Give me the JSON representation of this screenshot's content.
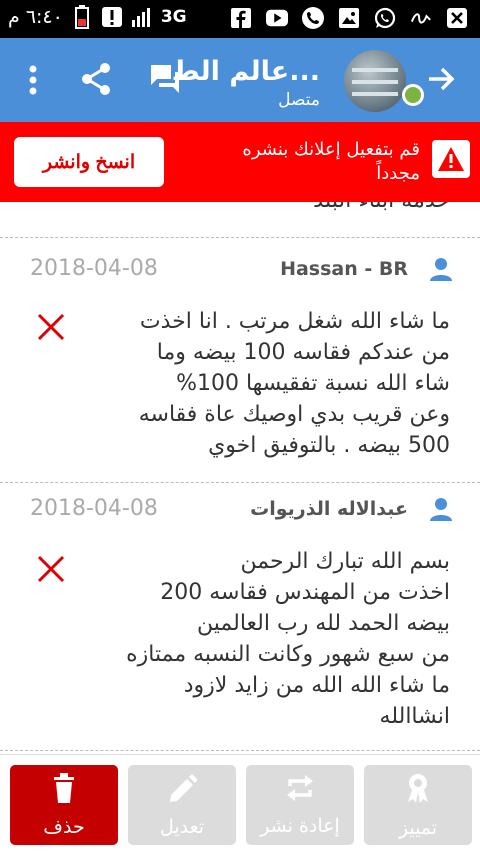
{
  "status_bar": {
    "time": "٦:٤٠ م",
    "network": "3G",
    "icons": [
      "battery-icon",
      "alert-icon",
      "signal-icon",
      "facebook-icon",
      "youtube-icon",
      "phone-icon",
      "gallery-icon",
      "whatsapp-icon",
      "ink-icon",
      "close-box-icon"
    ]
  },
  "app_bar": {
    "title": "عالم الط...",
    "subtitle": "متصل",
    "color": "#4A8FD7"
  },
  "alert": {
    "message": "قم بتفعيل إعلانك بنشره مجدداً",
    "button_label": "انسخ وانشر",
    "color": "#FF0000"
  },
  "feed": {
    "top_fragment": "خدمة ابناء البلد",
    "reviews": [
      {
        "name": "Hassan - BR",
        "date": "2018-04-08",
        "text": "ما شاء الله شغل مرتب . انا اخذت\nمن عندكم فقاسه 100 بيضه وما\nشاء الله  نسبة تفقيسها  100%\nوعن قريب بدي  اوصيك عاة فقاسه\n500 بيضه .  بالتوفيق اخوي"
      },
      {
        "name": "عبدالاله الذريوات",
        "date": "2018-04-08",
        "text": "بسم الله تبارك الرحمن\nاخذت من المهندس فقاسه 200\nبيضه الحمد لله رب العالمين\nمن سبع شهور وكانت النسبه ممتازه\nما شاء الله الله من زايد لازود\nانشاالله"
      }
    ]
  },
  "bottom_bar": {
    "delete_label": "حذف",
    "edit_label": "تعديل",
    "republish_label": "إعادة نشر",
    "feature_label": "تمييز",
    "delete_color": "#C40000"
  }
}
